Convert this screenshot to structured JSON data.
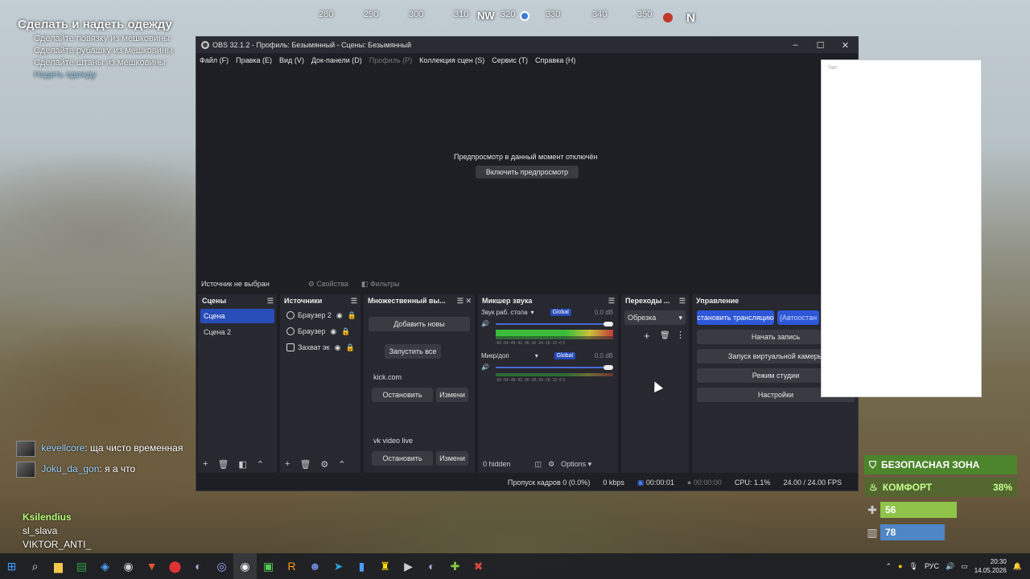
{
  "hud": {
    "compass": {
      "ticks": [
        "280",
        "290",
        "300",
        "310",
        "320",
        "330",
        "340",
        "350"
      ],
      "nw": "NW",
      "n": "N"
    },
    "quest": {
      "title": "Сделать и надеть одежду",
      "items": [
        "Сделайте повязку из мешковины",
        "Сделайте рубашку из мешковины",
        "Сделайте штаны из мешковины",
        "Надеть одежду"
      ]
    },
    "chat": [
      {
        "user": "kevellcore",
        "text": ": ща чисто временная"
      },
      {
        "user": "Joku_da_gon",
        "text": ": я а что"
      }
    ],
    "viewers": [
      "Ksilendius",
      "sl_slava",
      "VIKTOR_ANTI_"
    ],
    "status": {
      "safe_zone": "БЕЗОПАСНАЯ ЗОНА",
      "comfort_label": "КОМФОРТ",
      "comfort_value": "38%",
      "health": "56",
      "health_level": 0.56,
      "hydration": "78",
      "hydration_level": 0.78
    }
  },
  "obs": {
    "title": "OBS 32.1.2 - Профиль: Безымянный - Сцены: Безымянный",
    "menu": [
      "Файл (F)",
      "Правка (E)",
      "Вид (V)",
      "Док-панели (D)",
      "Профиль (P)",
      "Коллекция сцен (S)",
      "Сервис (T)",
      "Справка (H)"
    ],
    "preview": {
      "message": "Предпросмотр в данный момент отключён",
      "enable_button": "Включить предпросмотр"
    },
    "source_bar": {
      "none_selected": "Источник не выбран",
      "properties": "Свойства",
      "filters": "Фильтры"
    },
    "scenes": {
      "header": "Сцены",
      "items": [
        "Сцена",
        "Сцена 2"
      ]
    },
    "sources": {
      "header": "Источники",
      "items": [
        "Браузер 2",
        "Браузер",
        "Захват эк"
      ]
    },
    "multi": {
      "header": "Множественный вы...",
      "add_button": "Добавить новы",
      "start_all": "Запустить все",
      "targets": [
        {
          "name": "kick.com",
          "stop": "Остановить",
          "edit": "Измени"
        },
        {
          "name": "vk video live",
          "stop": "Остановить",
          "edit": "Измени"
        }
      ]
    },
    "mixer": {
      "header": "Микшер звука",
      "channels": [
        {
          "name": "Звук раб. стола",
          "tag": "Global",
          "db": "0.0 dB"
        },
        {
          "name": "Микр/доп",
          "tag": "Global",
          "db": "0.0 dB"
        }
      ],
      "scale": "-60 -54 -48 -42 -36 -30 -24 -18 -12 -6 0",
      "hidden": "0 hidden",
      "options": "Options"
    },
    "transitions": {
      "header": "Переходы ...",
      "selected": "Обрезка"
    },
    "controls": {
      "header": "Управление",
      "stop_stream": "становить трансляцию",
      "auto": "(Автоостан",
      "record": "Начать запись",
      "virtual_cam": "Запуск виртуальной камеры",
      "studio": "Режим студии",
      "settings": "Настройки"
    },
    "statusbar": {
      "dropped": "Пропуск кадров 0 (0.0%)",
      "kbps": "0 kbps",
      "stream_time": "00:00:01",
      "rec_time": "00:00:00",
      "cpu": "CPU: 1.1%",
      "fps": "24.00 / 24.00 FPS"
    }
  },
  "chat_popup": {
    "title": "Чат"
  },
  "taskbar": {
    "lang": "РУС",
    "time": "20:30",
    "date": "14.05.2026"
  }
}
